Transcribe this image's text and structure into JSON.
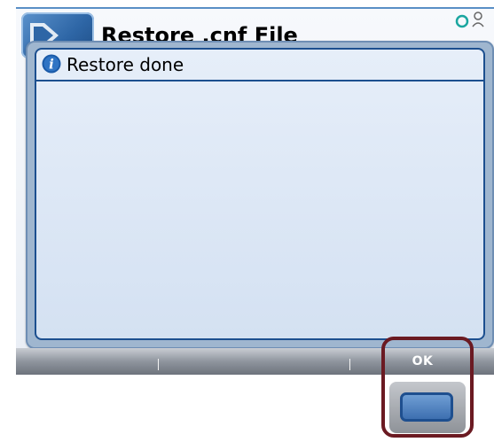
{
  "screen": {
    "title": "Restore .cnf File"
  },
  "dialog": {
    "title": "Restore done",
    "icon": "info-icon"
  },
  "softkeys": {
    "labels": [
      "",
      "",
      "OK"
    ]
  },
  "colors": {
    "accent": "#1c4f8f",
    "dialog_bg": "#dce7f5",
    "highlight": "#6b1a22"
  }
}
